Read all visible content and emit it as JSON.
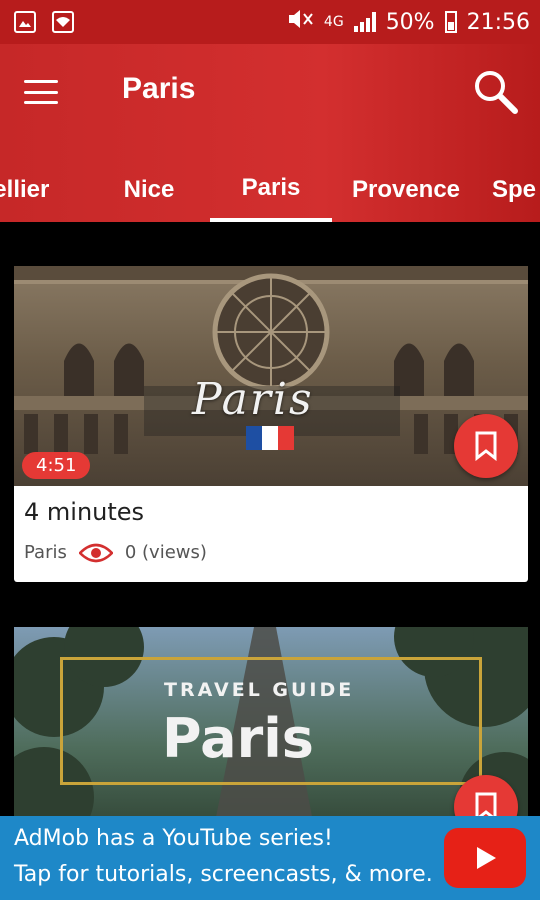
{
  "status_bar": {
    "network": "4G",
    "battery": "50%",
    "time": "21:56",
    "icons": [
      "image-icon",
      "wifi-icon",
      "mute-icon",
      "signal-icon",
      "battery-icon"
    ]
  },
  "app_bar": {
    "title": "Paris",
    "color": "#d32f2f"
  },
  "tabs": [
    {
      "label": "Montpellier",
      "shown": "pellier"
    },
    {
      "label": "Nice"
    },
    {
      "label": "Paris",
      "active": true
    },
    {
      "label": "Provence"
    },
    {
      "label": "Spe",
      "shown": "Spe"
    }
  ],
  "videos": [
    {
      "overlay_text": "Paris",
      "duration": "4:51",
      "title": "4 minutes",
      "location": "Paris",
      "views": "0 (views)"
    },
    {
      "overlay_small": "TRAVEL GUIDE",
      "overlay_big": "Paris"
    }
  ],
  "ad": {
    "line1": "AdMob has a YouTube series!",
    "line2": "Tap for tutorials, screencasts, & more."
  }
}
